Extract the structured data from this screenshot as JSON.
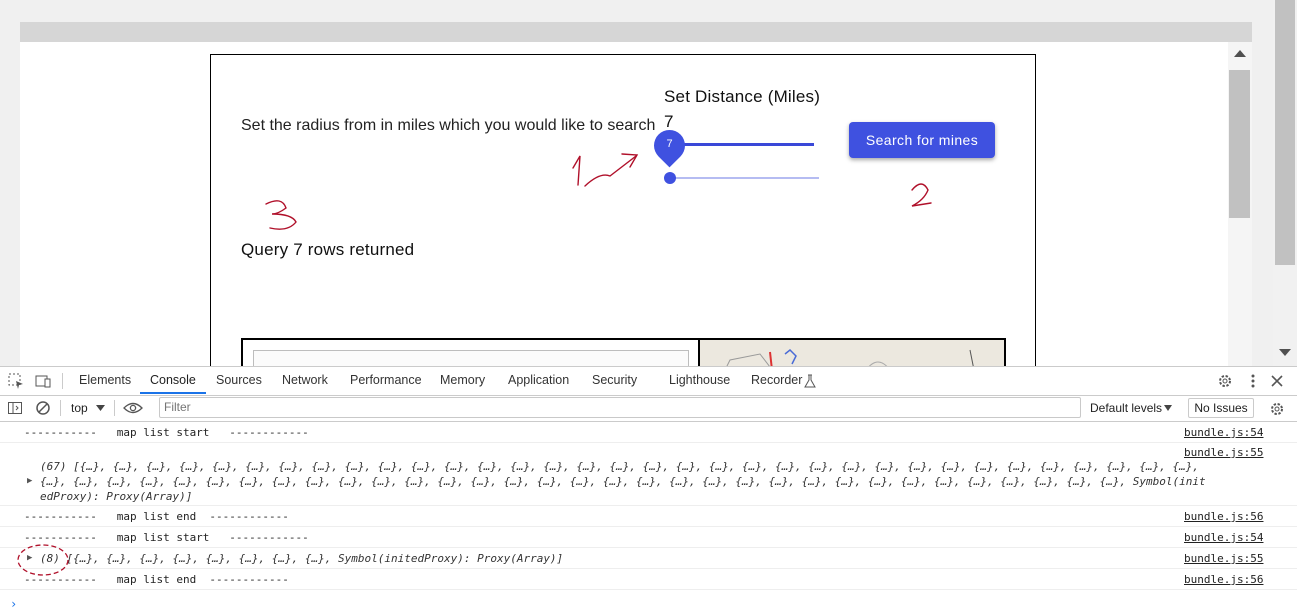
{
  "app": {
    "prompt_text": "Set the radius from  in miles which you would like to search",
    "distance_title": "Set Distance (Miles)",
    "distance_value": "7",
    "slider_bubble": "7",
    "search_button": "Search for mines",
    "query_label": "Query 7 rows returned"
  },
  "annotations": [
    "1",
    "2",
    "3"
  ],
  "devtools": {
    "tabs": [
      "Elements",
      "Console",
      "Sources",
      "Network",
      "Performance",
      "Memory",
      "Application",
      "Security",
      "Lighthouse",
      "Recorder"
    ],
    "active_tab": "Console",
    "context": "top",
    "filter_placeholder": "Filter",
    "levels_label": "Default levels",
    "issues_label": "No Issues",
    "console": [
      {
        "message": "-----------   map list start   ------------",
        "source": "bundle.js:54"
      },
      {
        "message": "(67) [{…}, {…}, {…}, {…}, {…}, {…}, {…}, {…}, {…}, {…}, {…}, {…}, {…}, {…}, {…}, {…}, {…}, {…}, {…}, {…}, {…}, {…}, {…}, {…}, {…}, {…}, {…}, {…}, {…}, {…}, {…}, {…}, {…}, {…},",
        "message_2": "{…}, {…}, {…}, {…}, {…}, {…}, {…}, {…}, {…}, {…}, {…}, {…}, {…}, {…}, {…}, {…}, {…}, {…}, {…}, {…}, {…}, {…}, {…}, {…}, {…}, {…}, {…}, {…}, {…}, {…}, {…}, {…}, {…}, Symbol(init",
        "message_3": "edProxy): Proxy(Array)]",
        "source": "bundle.js:55"
      },
      {
        "message": "-----------   map list end  ------------",
        "source": "bundle.js:56"
      },
      {
        "message": "-----------   map list start   ------------",
        "source": "bundle.js:54"
      },
      {
        "message": "(8) [{…}, {…}, {…}, {…}, {…}, {…}, {…}, {…}, Symbol(initedProxy): Proxy(Array)]",
        "source": "bundle.js:55"
      },
      {
        "message": "-----------   map list end  ------------",
        "source": "bundle.js:56"
      }
    ]
  },
  "colors": {
    "accent": "#3f51e0",
    "devtools_blue": "#1a73e8",
    "annotation": "#b0102a"
  }
}
